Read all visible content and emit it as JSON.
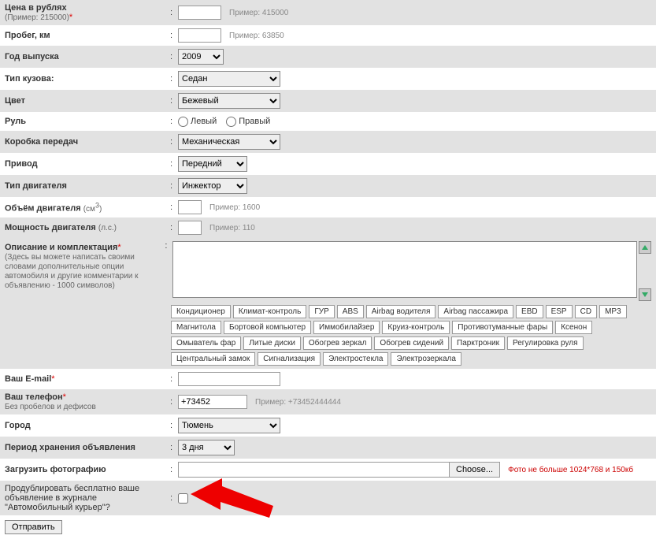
{
  "fields": {
    "price": {
      "label": "Цена в рублях",
      "sub": "(Пример: 215000)",
      "hint": "Пример: 415000"
    },
    "mileage": {
      "label": "Пробег, км",
      "hint": "Пример: 63850"
    },
    "year": {
      "label": "Год выпуска",
      "value": "2009"
    },
    "body": {
      "label": "Тип кузова:",
      "value": "Седан"
    },
    "color": {
      "label": "Цвет",
      "value": "Бежевый"
    },
    "wheel": {
      "label": "Руль",
      "left": "Левый",
      "right": "Правый"
    },
    "gearbox": {
      "label": "Коробка передач",
      "value": "Механическая"
    },
    "drive": {
      "label": "Привод",
      "value": "Передний"
    },
    "engine_type": {
      "label": "Тип двигателя",
      "value": "Инжектор"
    },
    "volume": {
      "label": "Объём двигателя",
      "unit_html": "(см",
      "sup": "3",
      "unit_close": ")",
      "hint": "Пример: 1600"
    },
    "power": {
      "label": "Мощность двигателя",
      "unit": "(л.с.)",
      "hint": "Пример: 110"
    },
    "desc": {
      "label": "Описание и комплектация",
      "sub": "(Здесь вы можете написать своими словами дополнительные опции автомобиля и другие комментарии к объявлению - 1000 символов)"
    },
    "email": {
      "label": "Ваш E-mail"
    },
    "phone": {
      "label": "Ваш телефон",
      "sub": "Без пробелов и дефисов",
      "value": "+73452",
      "hint": "Пример: +73452444444"
    },
    "city": {
      "label": "Город",
      "value": "Тюмень"
    },
    "period": {
      "label": "Период хранения объявления",
      "value": "3 дня"
    },
    "photo": {
      "label": "Загрузить фотографию",
      "btn": "Choose...",
      "warn": "Фото не больше 1024*768 и 150кб"
    },
    "duplicate": {
      "label": "Продублировать бесплатно ваше объявление в журнале \"Автомобильный курьер\"?"
    },
    "submit": "Отправить"
  },
  "tags": [
    "Кондиционер",
    "Климат-контроль",
    "ГУР",
    "ABS",
    "Airbag водителя",
    "Airbag пассажира",
    "EBD",
    "ESP",
    "CD",
    "MP3",
    "Магнитола",
    "Бортовой компьютер",
    "Иммобилайзер",
    "Круиз-контроль",
    "Противотуманные фары",
    "Ксенон",
    "Омыватель фар",
    "Литые диски",
    "Обогрев зеркал",
    "Обогрев сидений",
    "Парктроник",
    "Регулировка руля",
    "Центральный замок",
    "Сигнализация",
    "Электростекла",
    "Электрозеркала"
  ]
}
